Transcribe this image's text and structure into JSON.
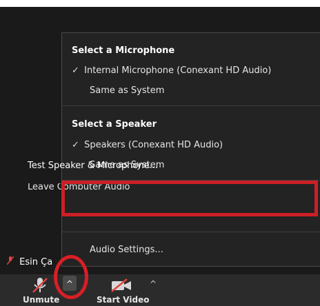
{
  "menu": {
    "microphone_section_title": "Select a Microphone",
    "microphone_items": [
      {
        "label": "Internal Microphone (Conexant HD Audio)",
        "checked": true
      },
      {
        "label": "Same as System",
        "checked": false
      }
    ],
    "speaker_section_title": "Select a Speaker",
    "speaker_items": [
      {
        "label": "Speakers (Conexant HD Audio)",
        "checked": true
      },
      {
        "label": "Same as System",
        "checked": false
      }
    ],
    "test_label": "Test Speaker & Microphone...",
    "leave_label": "Leave Computer Audio",
    "audio_settings_label": "Audio Settings...",
    "check_glyph": "✓"
  },
  "participant": {
    "name": "Esin Ça"
  },
  "toolbar": {
    "unmute_label": "Unmute",
    "start_video_label": "Start Video",
    "caret_glyph": "^"
  },
  "colors": {
    "annotation_red": "#cc1f26",
    "menu_bg": "#232323",
    "toolbar_bg": "#2b2b2b"
  },
  "icons": {
    "mic": "microphone-muted-icon",
    "video": "video-off-icon",
    "caret": "chevron-up-icon",
    "check": "check-icon"
  }
}
